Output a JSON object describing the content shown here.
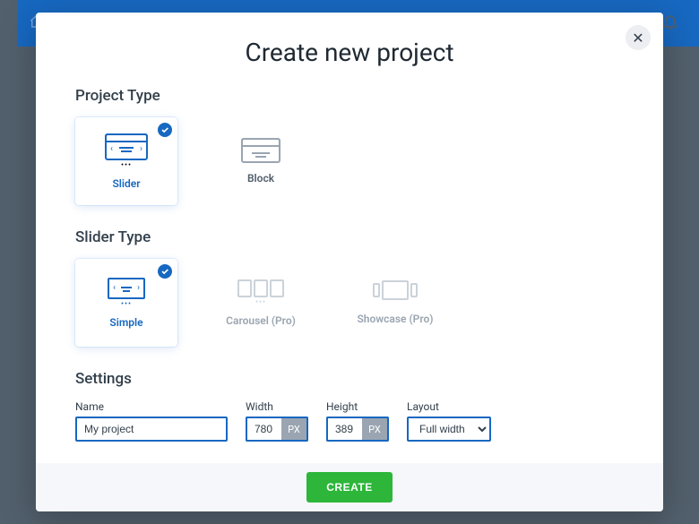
{
  "modal": {
    "title": "Create new project",
    "close_glyph": "✕"
  },
  "sections": {
    "project_type_label": "Project Type",
    "slider_type_label": "Slider Type",
    "settings_label": "Settings"
  },
  "project_types": [
    {
      "label": "Slider",
      "selected": true
    },
    {
      "label": "Block",
      "selected": false
    }
  ],
  "slider_types": [
    {
      "label": "Simple",
      "selected": true,
      "disabled": false
    },
    {
      "label": "Carousel (Pro)",
      "selected": false,
      "disabled": true
    },
    {
      "label": "Showcase (Pro)",
      "selected": false,
      "disabled": true
    }
  ],
  "settings": {
    "name": {
      "label": "Name",
      "value": "My project"
    },
    "width": {
      "label": "Width",
      "value": "780",
      "unit": "PX"
    },
    "height": {
      "label": "Height",
      "value": "389",
      "unit": "PX"
    },
    "layout": {
      "label": "Layout",
      "value": "Full width"
    }
  },
  "footer": {
    "create_label": "CREATE"
  }
}
